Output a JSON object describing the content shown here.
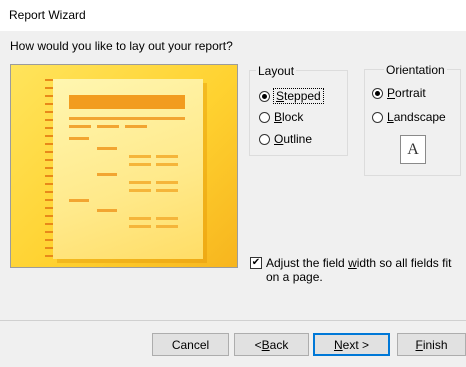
{
  "window": {
    "title": "Report Wizard"
  },
  "question": "How would you like to lay out your report?",
  "layout": {
    "group_label": "Layout",
    "options": [
      {
        "pre": "",
        "key": "S",
        "post": "tepped",
        "selected": true
      },
      {
        "pre": "",
        "key": "B",
        "post": "lock",
        "selected": false
      },
      {
        "pre": "",
        "key": "O",
        "post": "utline",
        "selected": false
      }
    ]
  },
  "orientation": {
    "group_label": "Orientation",
    "options": [
      {
        "pre": "",
        "key": "P",
        "post": "ortrait",
        "selected": true
      },
      {
        "pre": "",
        "key": "L",
        "post": "andscape",
        "selected": false
      }
    ],
    "page_icon_letter": "A"
  },
  "adjust": {
    "checked": true,
    "pre": "Adjust the field ",
    "key": "w",
    "post": "idth so all fields fit on a page."
  },
  "buttons": {
    "cancel": "Cancel",
    "back_pre": "< ",
    "back_key": "B",
    "back_post": "ack",
    "next_pre": "",
    "next_key": "N",
    "next_post": "ext >",
    "finish_pre": "",
    "finish_key": "F",
    "finish_post": "inish"
  },
  "colors": {
    "accent": "#0078d7",
    "preview_orange": "#f29c1f",
    "preview_yellow": "#ffd230"
  }
}
